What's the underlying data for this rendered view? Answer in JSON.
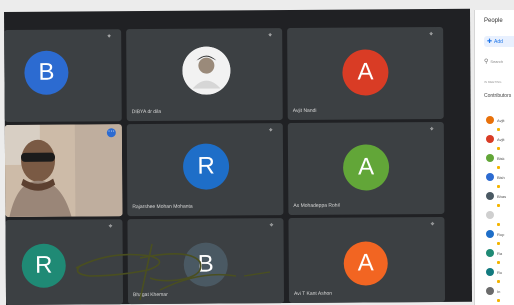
{
  "tiles": [
    {
      "id": "t1",
      "initial": "B",
      "avatar_color": "#2c6bd1",
      "name": ""
    },
    {
      "id": "t2",
      "initial": "",
      "avatar_color": "#e8e8e8",
      "name": "DIBYA dr dila",
      "is_photo": true
    },
    {
      "id": "t3",
      "initial": "A",
      "avatar_color": "#d93c25",
      "name": "Avjit Nandi"
    },
    {
      "id": "t4",
      "initial": "",
      "avatar_color": "",
      "name": "",
      "is_video": true
    },
    {
      "id": "t5",
      "initial": "R",
      "avatar_color": "#1e6ec8",
      "name": "Rajarshee Mohan Mohanta"
    },
    {
      "id": "t6",
      "initial": "A",
      "avatar_color": "#62a638",
      "name": "As Mohadeppa Rohil"
    },
    {
      "id": "t7",
      "initial": "R",
      "avatar_color": "#1f8a75",
      "name": ""
    },
    {
      "id": "t8",
      "initial": "B",
      "avatar_color": "#4a5963",
      "name": "Bhagat Khemar"
    },
    {
      "id": "t9",
      "initial": "A",
      "avatar_color": "#f26522",
      "name": "Avi T Kant Ashon"
    }
  ],
  "panel": {
    "title": "People",
    "add_label": "Add",
    "search_placeholder": "Search",
    "section_label": "IN MEETING",
    "contributors_label": "Contributors",
    "people": [
      {
        "initial": "",
        "color": "#e8710a",
        "label": "Avjit"
      },
      {
        "initial": "",
        "color": "#d93c25",
        "label": "Avjit"
      },
      {
        "initial": "",
        "color": "#62a638",
        "label": "Bisk"
      },
      {
        "initial": "",
        "color": "#2c6bd1",
        "label": "Bish"
      },
      {
        "initial": "",
        "color": "#4a5963",
        "label": "Bhas"
      },
      {
        "initial": "",
        "color": "#cfcfcf",
        "label": ""
      },
      {
        "initial": "",
        "color": "#1e6ec8",
        "label": "Rup"
      },
      {
        "initial": "",
        "color": "#1f8a75",
        "label": "Ra"
      },
      {
        "initial": "",
        "color": "#137a7f",
        "label": "Ru"
      },
      {
        "initial": "",
        "color": "#6b6b6b",
        "label": "In"
      }
    ]
  }
}
